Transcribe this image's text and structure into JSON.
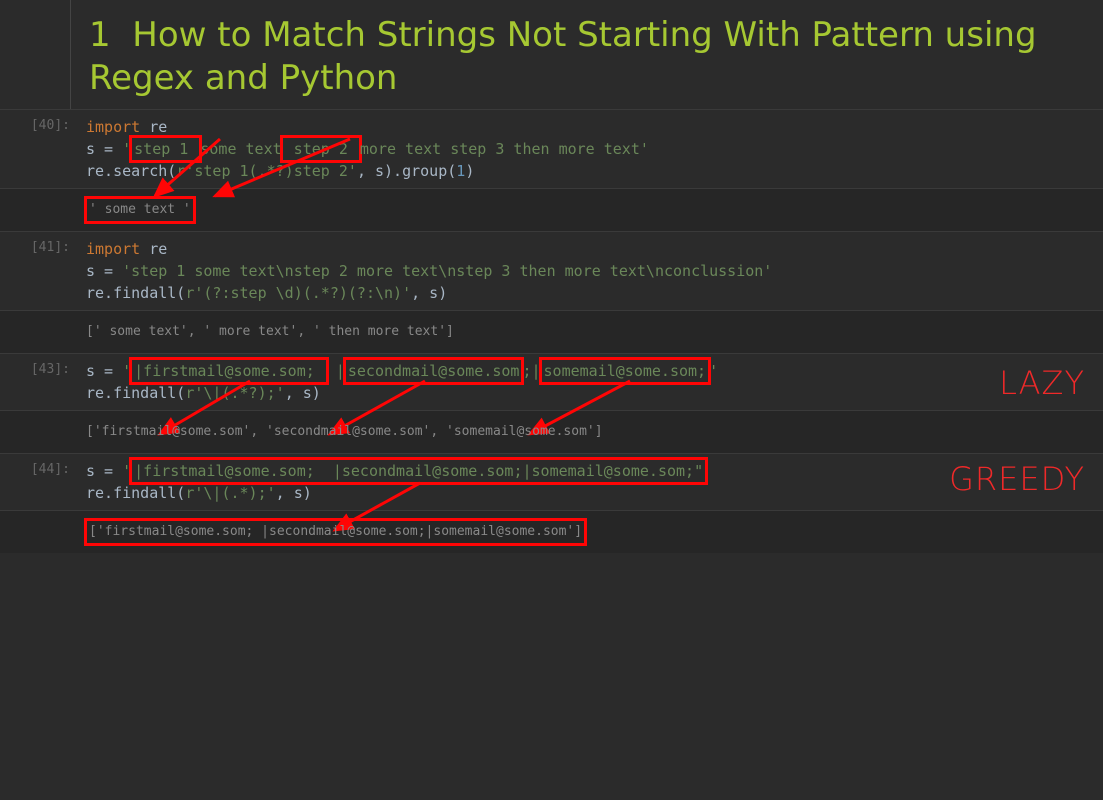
{
  "header": {
    "number": "1",
    "title": "How to Match Strings Not Starting With Pattern using Regex and Python"
  },
  "cells": [
    {
      "prompt": "[40]:",
      "code": {
        "l1_kw": "import",
        "l1_rest": " re",
        "l2_pre": "s = ",
        "l2_q1": "'",
        "l2_box1": "step 1 ",
        "l2_mid": "some text",
        "l2_box2": " step 2 ",
        "l2_rest": "more text step 3 then more text'",
        "l3_pre": "re.search(",
        "l3_str": "r'step 1(.*?)step 2'",
        "l3_mid": ", s).group(",
        "l3_num": "1",
        "l3_end": ")"
      },
      "out": "' some text '"
    },
    {
      "prompt": "[41]:",
      "code": {
        "l1_kw": "import",
        "l1_rest": " re",
        "l2_pre": "s = ",
        "l2_str": "'step 1 some text\\nstep 2 more text\\nstep 3 then more text\\nconclussion'",
        "l3_pre": "re.findall(",
        "l3_str": "r'(?:step \\d)(.*?)(?:\\n)'",
        "l3_end": ", s)"
      },
      "out": "[' some text', ' more text', ' then more text']"
    },
    {
      "prompt": "[43]:",
      "label": "LAZY",
      "code": {
        "l1_pre": "s = ",
        "l1_q": "'",
        "l1_box1": "|firstmail@some.som; ",
        "l1_gap1": " |",
        "l1_box2": "secondmail@some.som",
        "l1_gap2": ";|",
        "l1_box3": "somemail@some.som;",
        "l1_end": "'",
        "l2_pre": "re.findall(",
        "l2_str": "r'\\|(.*?);'",
        "l2_end": ", s)"
      },
      "out": "['firstmail@some.som', 'secondmail@some.som', 'somemail@some.som']"
    },
    {
      "prompt": "[44]:",
      "label": "GREEDY",
      "code": {
        "l1_pre": "s = ",
        "l1_q": "'",
        "l1_box": "|firstmail@some.som;  |secondmail@some.som;|somemail@some.som;\"",
        "l2_pre": "re.findall(",
        "l2_str": "r'\\|(.*);'",
        "l2_end": ", s)"
      },
      "out": "['firstmail@some.som;  |secondmail@some.som;|somemail@some.som']"
    }
  ]
}
